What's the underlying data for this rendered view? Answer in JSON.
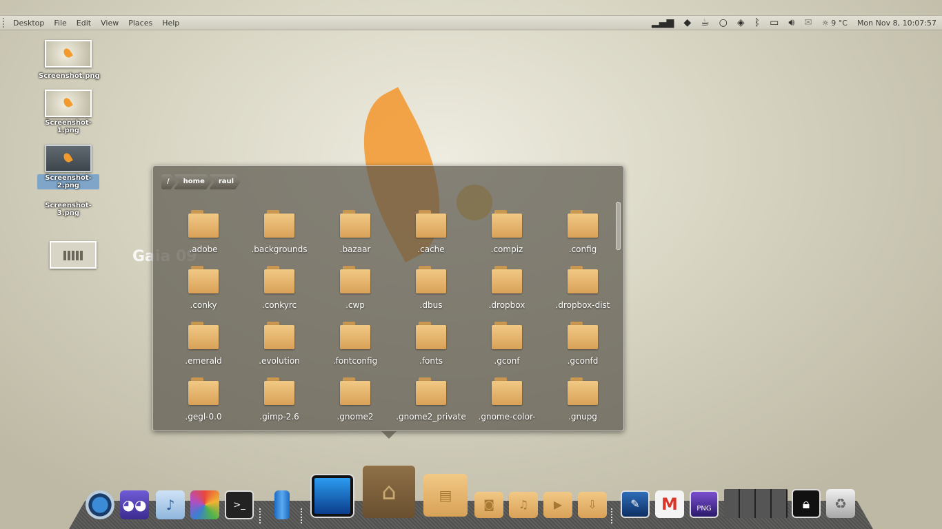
{
  "panel": {
    "menu": [
      "Desktop",
      "File",
      "Edit",
      "View",
      "Places",
      "Help"
    ],
    "tray_icons": [
      "signal-icon",
      "dropbox-icon",
      "coffee-icon",
      "lightbulb-icon",
      "navigation-icon",
      "bluetooth-icon",
      "battery-icon",
      "volume-icon",
      "mail-icon"
    ],
    "weather": "9 °C",
    "clock": "Mon Nov  8, 10:07:57"
  },
  "desktop_icons": [
    {
      "label": "Screenshot.png"
    },
    {
      "label": "Screenshot-1.png"
    },
    {
      "label": "Screenshot-2.png"
    },
    {
      "label": "Screenshot-3.png"
    }
  ],
  "watermark": "Gaia 09",
  "stack": {
    "breadcrumbs": [
      "/",
      "home",
      "raul"
    ],
    "folders": [
      ".adobe",
      ".backgrounds",
      ".bazaar",
      ".cache",
      ".compiz",
      ".config",
      ".conky",
      ".conkyrc",
      ".cwp",
      ".dbus",
      ".dropbox",
      ".dropbox-dist",
      ".emerald",
      ".evolution",
      ".fontconfig",
      ".fonts",
      ".gconf",
      ".gconfd",
      ".gegl-0.0",
      ".gimp-2.6",
      ".gnome2",
      ".gnome2_private",
      ".gnome-color-",
      ".gnupg"
    ]
  },
  "dock": {
    "items": [
      "chromium-icon",
      "pidgin-icon",
      "music-icon",
      "gimp-icon",
      "terminal-icon",
      "bottle-icon",
      "monitor-icon",
      "home-folder-icon",
      "documents-folder-icon",
      "pictures-folder-icon",
      "music-folder-icon",
      "videos-folder-icon",
      "downloads-folder-icon",
      "screenshot-tool-icon",
      "gmail-icon",
      "png-icon",
      "workspace-switcher-icon",
      "lock-icon",
      "trash-icon"
    ]
  },
  "colors": {
    "folder": "#e6b36c",
    "panel": "#d8d6ca",
    "selection": "#7fa6c9"
  }
}
